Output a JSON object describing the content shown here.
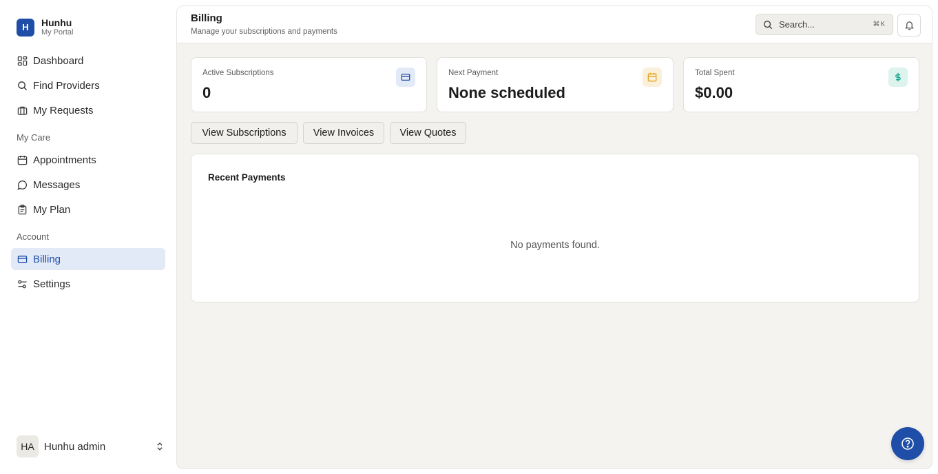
{
  "brand": {
    "logo_letter": "H",
    "name": "Hunhu",
    "subtitle": "My Portal",
    "accent_color": "#1f4ea8"
  },
  "sidebar": {
    "items": [
      {
        "label": "Dashboard",
        "icon": "dashboard-icon"
      },
      {
        "label": "Find Providers",
        "icon": "search-icon"
      },
      {
        "label": "My Requests",
        "icon": "briefcase-icon"
      },
      {
        "label": "Appointments",
        "icon": "calendar-icon"
      },
      {
        "label": "Messages",
        "icon": "message-icon"
      },
      {
        "label": "My Plan",
        "icon": "clipboard-icon"
      },
      {
        "label": "Billing",
        "icon": "credit-card-icon",
        "active": true
      },
      {
        "label": "Settings",
        "icon": "settings-sliders-icon"
      }
    ],
    "sections": {
      "care": "My Care",
      "account": "Account"
    }
  },
  "user": {
    "initials": "HA",
    "name": "Hunhu admin"
  },
  "header": {
    "title": "Billing",
    "subtitle": "Manage your subscriptions and payments",
    "search_placeholder": "Search...",
    "search_shortcut": "⌘K"
  },
  "stats": [
    {
      "label": "Active Subscriptions",
      "value": "0",
      "icon": "credit-card-icon",
      "color": "#1f4ea8"
    },
    {
      "label": "Next Payment",
      "value": "None scheduled",
      "icon": "calendar-icon",
      "color": "#e0a320"
    },
    {
      "label": "Total Spent",
      "value": "$0.00",
      "icon": "dollar-icon",
      "color": "#1aa58a"
    }
  ],
  "actions": {
    "subscriptions": "View Subscriptions",
    "invoices": "View Invoices",
    "quotes": "View Quotes"
  },
  "recent_payments": {
    "title": "Recent Payments",
    "empty_text": "No payments found."
  }
}
